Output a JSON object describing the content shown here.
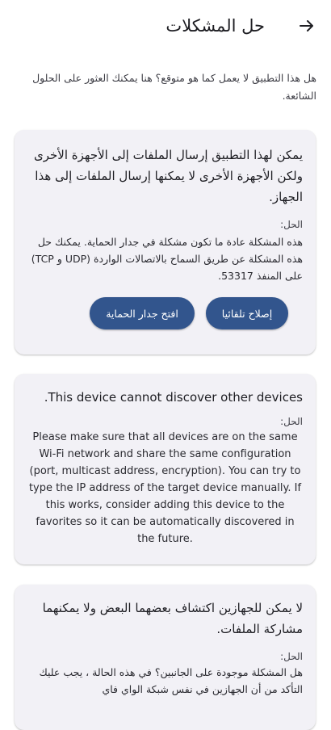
{
  "header": {
    "title": "حل المشكلات",
    "back_icon": "arrow-forward-icon"
  },
  "intro": "هل هذا التطبيق لا يعمل كما هو متوقع؟ هنا يمكنك العثور على الحلول الشائعة.",
  "cards": [
    {
      "title": "يمكن لهذا التطبيق إرسال الملفات إلى الأجهزة الأخرى ولكن الأجهزة الأخرى لا يمكنها إرسال الملفات إلى هذا الجهاز.",
      "solution_label": "الحل:",
      "solution": "هذه المشكلة عادة ما تكون مشكلة في جدار الحماية. يمكنك حل هذه المشكلة عن طريق السماح بالاتصالات الواردة (UDP و TCP) على المنفذ 53317.",
      "buttons": [
        "إصلاح تلقائيا",
        "افتح جدار الحماية"
      ]
    },
    {
      "title": "This device cannot discover other devices.",
      "solution_label": "الحل:",
      "solution": "Please make sure that all devices are on the same Wi-Fi network and share the same configuration (port, multicast address, encryption). You can try to type the IP address of the target device manually. If this works, consider adding this device to the favorites so it can be automatically discovered in the future."
    },
    {
      "title": "لا يمكن للجهازين اكتشاف بعضهما البعض ولا يمكنهما مشاركة الملفات.",
      "solution_label": "الحل:",
      "solution": "هل المشكلة موجودة على الجانبين؟ في هذه الحالة ، يجب عليك التأكد من أن الجهازين في نفس شبكة الواي فاي"
    }
  ],
  "colors": {
    "button": "#32558d",
    "card": "#f2f1f6"
  }
}
